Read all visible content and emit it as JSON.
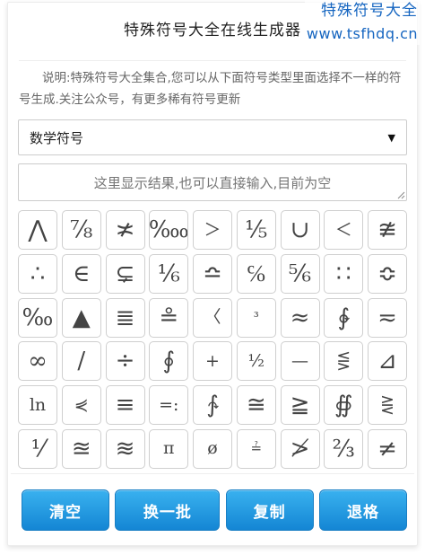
{
  "header": {
    "title": "特殊符号大全在线生成器"
  },
  "watermark": {
    "name": "特殊符号大全",
    "url": "www.tsfhdq.cn"
  },
  "description": "说明:特殊符号大全集合,您可以从下面符号类型里面选择不一样的符号生成.关注公众号，有更多稀有符号更新",
  "category_select": {
    "selected": "数学符号",
    "caret_icon": "triangle-down-icon"
  },
  "result_box": {
    "placeholder": "这里显示结果,也可以直接输入,目前为空"
  },
  "symbols": [
    "⋀",
    "⅞",
    "≭",
    "‱",
    "＞",
    "⅕",
    "∪",
    "＜",
    "≇",
    "∴",
    "∈",
    "⊊",
    "⅙",
    "≏",
    "℅",
    "⅚",
    "∷",
    "≎",
    "‰",
    "▲",
    "≣",
    "≗",
    "〈",
    "³",
    "≈",
    "∲",
    "≂",
    "∞",
    "∕",
    "÷",
    "∮",
    "+",
    "½",
    "—",
    "⋚",
    "⊿",
    "ln",
    "⋞",
    "≡",
    "=:",
    "∱",
    "≅",
    "≧",
    "∯",
    "⋛",
    "⅟",
    "≊",
    "≋",
    "π",
    "ø",
    "≟",
    "≯",
    "⅔",
    "≠"
  ],
  "buttons": {
    "clear": "清空",
    "refresh": "换一批",
    "copy": "复制",
    "backspace": "退格"
  },
  "colors": {
    "button_top": "#39b1ef",
    "button_bottom": "#1486d4",
    "watermark": "#1565c0"
  }
}
